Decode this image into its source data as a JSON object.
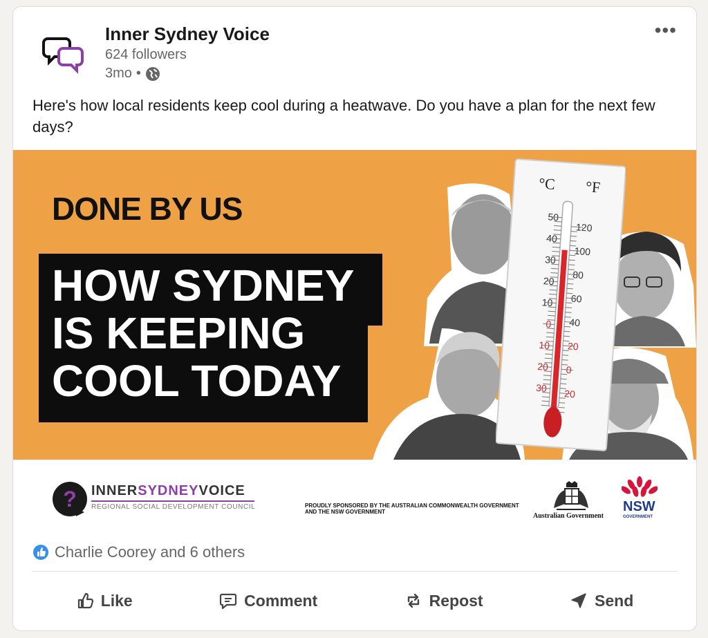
{
  "post": {
    "author": "Inner Sydney Voice",
    "followers": "624 followers",
    "time": "3mo",
    "dot": "•",
    "more": "•••",
    "text": "Here's how local residents keep cool during a heatwave. Do you have a plan for the next few days?"
  },
  "banner": {
    "kicker": "DONE BY US",
    "headline_lines": [
      "HOW SYDNEY",
      "IS KEEPING",
      "COOL TODAY"
    ],
    "thermometer": {
      "celsius_label": "°C",
      "fahrenheit_label": "°F",
      "celsius_ticks": [
        "50",
        "40",
        "30",
        "20",
        "10",
        "0",
        "10",
        "20",
        "30"
      ],
      "fahrenheit_ticks": [
        "120",
        "100",
        "80",
        "60",
        "40",
        "20",
        "0",
        "20"
      ],
      "reading_celsius": 35
    }
  },
  "sponsor": {
    "org_prefix": "INNER",
    "org_middle": "SYDNEY",
    "org_suffix": "VOICE",
    "org_sub": "REGIONAL SOCIAL DEVELOPMENT COUNCIL",
    "sponsor_text": "PROUDLY SPONSORED BY THE AUSTRALIAN COMMONWEALTH GOVERNMENT AND THE NSW GOVERNMENT",
    "ausgov": "Australian Government",
    "nsw": "NSW",
    "nsw_sub": "GOVERNMENT"
  },
  "reactions": {
    "text": "Charlie Coorey and 6 others"
  },
  "actions": {
    "like": "Like",
    "comment": "Comment",
    "repost": "Repost",
    "send": "Send"
  },
  "colors": {
    "banner_bg": "#eea145",
    "brand_purple": "#8e3fa6",
    "like_blue": "#378fe9",
    "nsw_red": "#d7153a",
    "nsw_blue": "#1d3a8f"
  }
}
